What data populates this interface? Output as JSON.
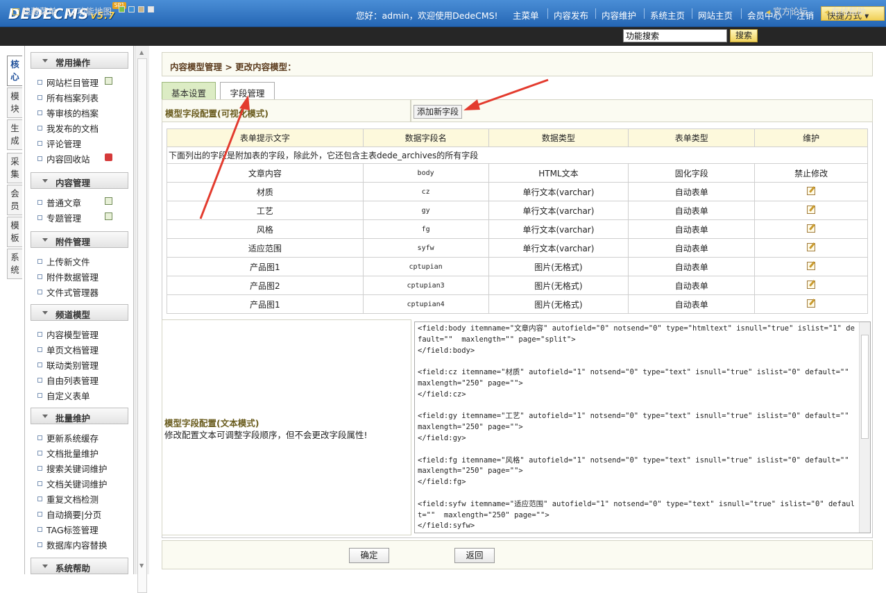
{
  "app": {
    "logo": "DEDECMS",
    "version": "v5.7",
    "badge": "SP1"
  },
  "header": {
    "welcome": "您好：admin，欢迎使用DedeCMS!",
    "nav": [
      "主菜单",
      "内容发布",
      "内容维护",
      "系统主页",
      "网站主页",
      "会员中心",
      "注销"
    ],
    "quick": "快捷方式"
  },
  "toolbar": {
    "hide_menu": "隐藏菜单",
    "func_map": "功能地图",
    "search_value": "功能搜索",
    "search_button": "搜索",
    "forum": "官方论坛",
    "help": "在线帮助"
  },
  "vtabs": [
    {
      "label": "核\n心",
      "active": true
    },
    {
      "label": "模\n块"
    },
    {
      "label": "生\n成"
    },
    {
      "label": "采\n集"
    },
    {
      "label": "会\n员"
    },
    {
      "label": "模\n板"
    },
    {
      "label": "系\n统"
    }
  ],
  "menu": {
    "sections": [
      {
        "title": "常用操作",
        "items": [
          "网站栏目管理",
          "所有档案列表",
          "等审核的档案",
          "我发布的文档",
          "评论管理",
          "内容回收站"
        ]
      },
      {
        "title": "内容管理",
        "items": [
          "普通文章",
          "专题管理"
        ]
      },
      {
        "title": "附件管理",
        "items": [
          "上传新文件",
          "附件数据管理",
          "文件式管理器"
        ]
      },
      {
        "title": "频道模型",
        "items": [
          "内容模型管理",
          "单页文档管理",
          "联动类别管理",
          "自由列表管理",
          "自定义表单"
        ]
      },
      {
        "title": "批量维护",
        "items": [
          "更新系统缓存",
          "文档批量维护",
          "搜索关键词维护",
          "文档关键词维护",
          "重复文档检测",
          "自动摘要|分页",
          "TAG标签管理",
          "数据库内容替换"
        ]
      },
      {
        "title": "系统帮助",
        "items": []
      }
    ]
  },
  "main": {
    "breadcrumb": "内容模型管理 > 更改内容模型：",
    "tabs": [
      "基本设置",
      "字段管理"
    ],
    "visual_title": "模型字段配置(可视化模式)",
    "add_field": "添加新字段",
    "columns": [
      "表单提示文字",
      "数据字段名",
      "数据类型",
      "表单类型",
      "维护"
    ],
    "note": "下面列出的字段是附加表的字段，除此外，它还包含主表dede_archives的所有字段",
    "rows": [
      {
        "label": "文章内容",
        "field": "body",
        "type": "HTML文本",
        "form": "固化字段",
        "action": "禁止修改"
      },
      {
        "label": "材质",
        "field": "cz",
        "type": "单行文本(varchar)",
        "form": "自动表单",
        "action": ""
      },
      {
        "label": "工艺",
        "field": "gy",
        "type": "单行文本(varchar)",
        "form": "自动表单",
        "action": ""
      },
      {
        "label": "风格",
        "field": "fg",
        "type": "单行文本(varchar)",
        "form": "自动表单",
        "action": ""
      },
      {
        "label": "适应范围",
        "field": "syfw",
        "type": "单行文本(varchar)",
        "form": "自动表单",
        "action": ""
      },
      {
        "label": "产品图1",
        "field": "cptupian",
        "type": "图片(无格式)",
        "form": "自动表单",
        "action": ""
      },
      {
        "label": "产品图2",
        "field": "cptupian3",
        "type": "图片(无格式)",
        "form": "自动表单",
        "action": ""
      },
      {
        "label": "产品图1",
        "field": "cptupian4",
        "type": "图片(无格式)",
        "form": "自动表单",
        "action": ""
      }
    ],
    "text_title": "模型字段配置(文本模式)",
    "text_sub": "修改配置文本可调整字段顺序，但不会更改字段属性!",
    "text_content": "<field:body itemname=\"文章内容\" autofield=\"0\" notsend=\"0\" type=\"htmltext\" isnull=\"true\" islist=\"1\" default=\"\"  maxlength=\"\" page=\"split\">\n</field:body>\n\n<field:cz itemname=\"材质\" autofield=\"1\" notsend=\"0\" type=\"text\" isnull=\"true\" islist=\"0\" default=\"\"  maxlength=\"250\" page=\"\">\n</field:cz>\n\n<field:gy itemname=\"工艺\" autofield=\"1\" notsend=\"0\" type=\"text\" isnull=\"true\" islist=\"0\" default=\"\"  maxlength=\"250\" page=\"\">\n</field:gy>\n\n<field:fg itemname=\"风格\" autofield=\"1\" notsend=\"0\" type=\"text\" isnull=\"true\" islist=\"0\" default=\"\"  maxlength=\"250\" page=\"\">\n</field:fg>\n\n<field:syfw itemname=\"适应范围\" autofield=\"1\" notsend=\"0\" type=\"text\" isnull=\"true\" islist=\"0\" default=\"\"  maxlength=\"250\" page=\"\">\n</field:syfw>",
    "ok": "确定",
    "back": "返回"
  },
  "colors": {
    "accent": "#2566b4",
    "annotation": "#e33b2e"
  }
}
